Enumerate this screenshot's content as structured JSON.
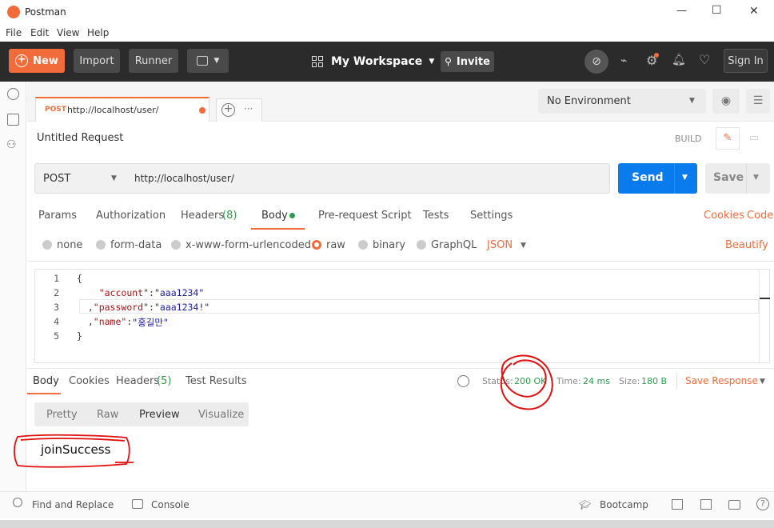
{
  "window": {
    "title": "Postman",
    "controls": [
      "—",
      "☐",
      "✕"
    ]
  },
  "menu": [
    "File",
    "Edit",
    "View",
    "Help"
  ],
  "toolbar": {
    "new": "New",
    "import": "Import",
    "runner": "Runner",
    "workspace": "My Workspace",
    "invite": "Invite",
    "signin": "Sign In"
  },
  "tab": {
    "method": "POST",
    "url": "http://localhost/user/"
  },
  "env": {
    "selected": "No Environment"
  },
  "request": {
    "name": "Untitled Request",
    "build": "BUILD",
    "method": "POST",
    "url": "http://localhost/user/",
    "send": "Send",
    "save": "Save"
  },
  "req_tabs": {
    "params": "Params",
    "authorization": "Authorization",
    "headers": "Headers",
    "headers_count": "(8)",
    "body": "Body",
    "prerequest": "Pre-request Script",
    "tests": "Tests",
    "settings": "Settings",
    "cookies": "Cookies",
    "code": "Code"
  },
  "body_types": {
    "none": "none",
    "form_data": "form-data",
    "urlencoded": "x-www-form-urlencoded",
    "raw": "raw",
    "binary": "binary",
    "graphql": "GraphQL",
    "format": "JSON",
    "beautify": "Beautify"
  },
  "editor": {
    "lines": [
      {
        "n": "1",
        "t": "{"
      },
      {
        "n": "2",
        "k": "\"account\"",
        "v": "\"aaa1234\"",
        "pre": "    "
      },
      {
        "n": "3",
        "k": "\"password\"",
        "v": "\"aaa1234!\"",
        "pre": "  ,"
      },
      {
        "n": "4",
        "k": "\"name\"",
        "v": "\"홍길만\"",
        "pre": "  ,"
      },
      {
        "n": "5",
        "t": "}"
      }
    ]
  },
  "resp_tabs": {
    "body": "Body",
    "cookies": "Cookies",
    "headers": "Headers",
    "headers_count": "(5)",
    "test_results": "Test Results"
  },
  "resp_meta": {
    "status_label": "Status:",
    "status": "200 OK",
    "time_label": "Time:",
    "time": "24 ms",
    "size_label": "Size:",
    "size": "180 B",
    "save_response": "Save Response"
  },
  "view_modes": {
    "pretty": "Pretty",
    "raw": "Raw",
    "preview": "Preview",
    "visualize": "Visualize"
  },
  "response": {
    "text": "joinSuccess"
  },
  "statusbar": {
    "find": "Find and Replace",
    "console": "Console",
    "bootcamp": "Bootcamp"
  },
  "colors": {
    "accent": "#f26b3a",
    "send": "#097bed",
    "status_ok": "#2a9d4a",
    "annotation": "#e01010"
  }
}
